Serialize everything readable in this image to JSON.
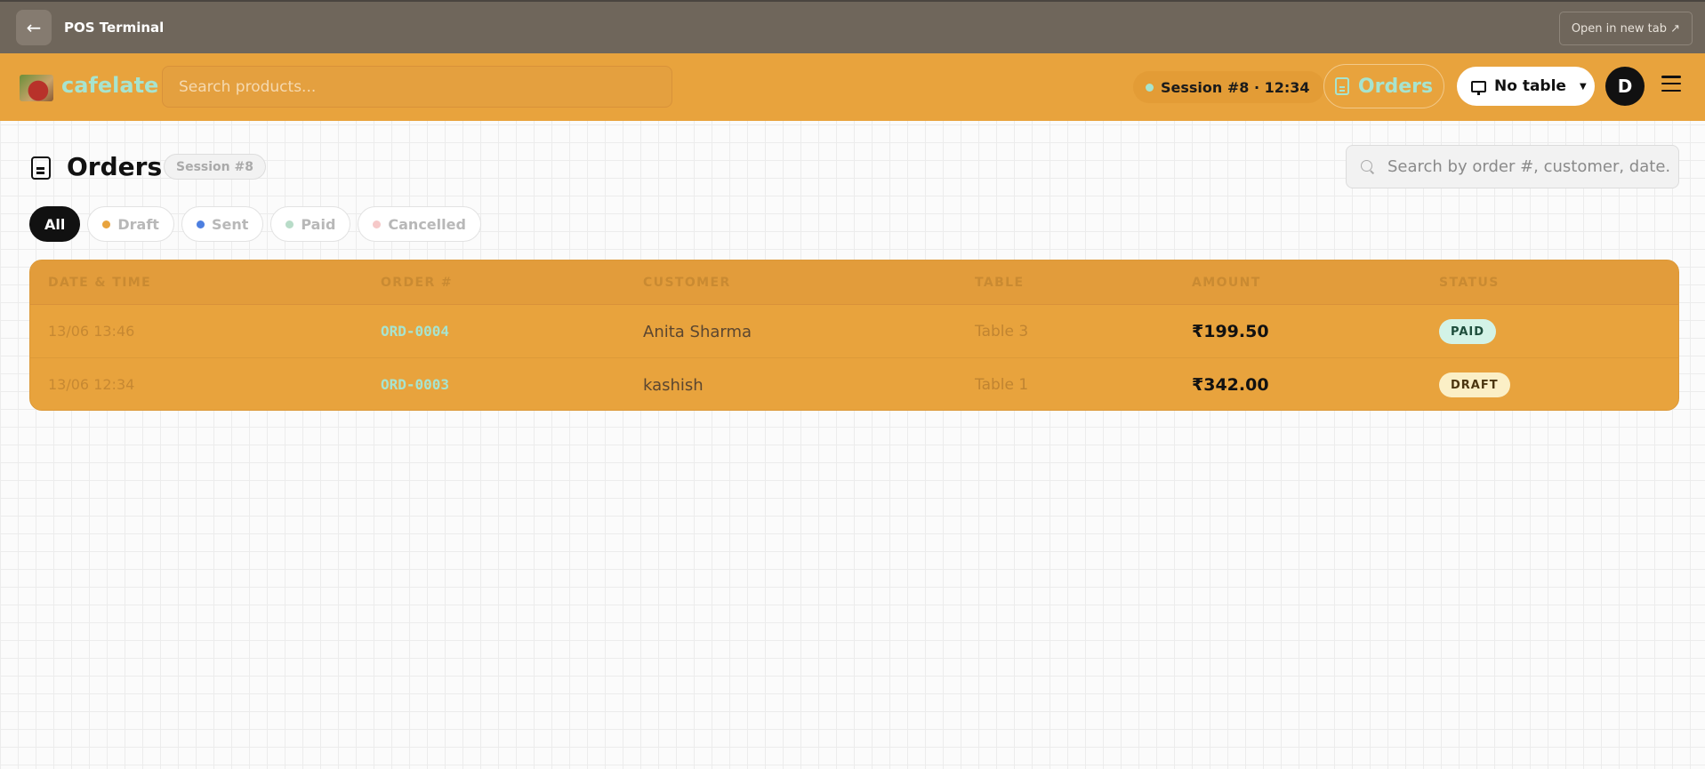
{
  "browser": {
    "back_icon": "←",
    "title": "POS Terminal",
    "open_new_tab": "Open in new tab ↗"
  },
  "header": {
    "brand": "cafelate",
    "search_placeholder": "Search products...",
    "session": "Session #8 · 12:34",
    "orders_label": "Orders",
    "table_label": "No table",
    "caret": "▼",
    "avatar_initial": "D"
  },
  "page": {
    "title": "Orders",
    "session_badge": "Session #8",
    "search_placeholder": "Search by order #, customer, date..."
  },
  "filters": [
    {
      "label": "All",
      "active": true,
      "color": ""
    },
    {
      "label": "Draft",
      "active": false,
      "color": "#e8a33d"
    },
    {
      "label": "Sent",
      "active": false,
      "color": "#4d7fe0"
    },
    {
      "label": "Paid",
      "active": false,
      "color": "#b8dcc8"
    },
    {
      "label": "Cancelled",
      "active": false,
      "color": "#f6c9c9"
    }
  ],
  "table": {
    "columns": [
      "DATE & TIME",
      "ORDER #",
      "CUSTOMER",
      "TABLE",
      "AMOUNT",
      "STATUS"
    ],
    "rows": [
      {
        "date": "13/06 13:46",
        "order": "ORD-0004",
        "customer": "Anita Sharma",
        "table": "Table 3",
        "amount": "₹199.50",
        "status": "PAID"
      },
      {
        "date": "13/06 12:34",
        "order": "ORD-0003",
        "customer": "kashish",
        "table": "Table 1",
        "amount": "₹342.00",
        "status": "DRAFT"
      }
    ]
  },
  "colors": {
    "accent": "#e8a33d",
    "mint": "#a7e4cf",
    "topbar": "#6f665b"
  }
}
